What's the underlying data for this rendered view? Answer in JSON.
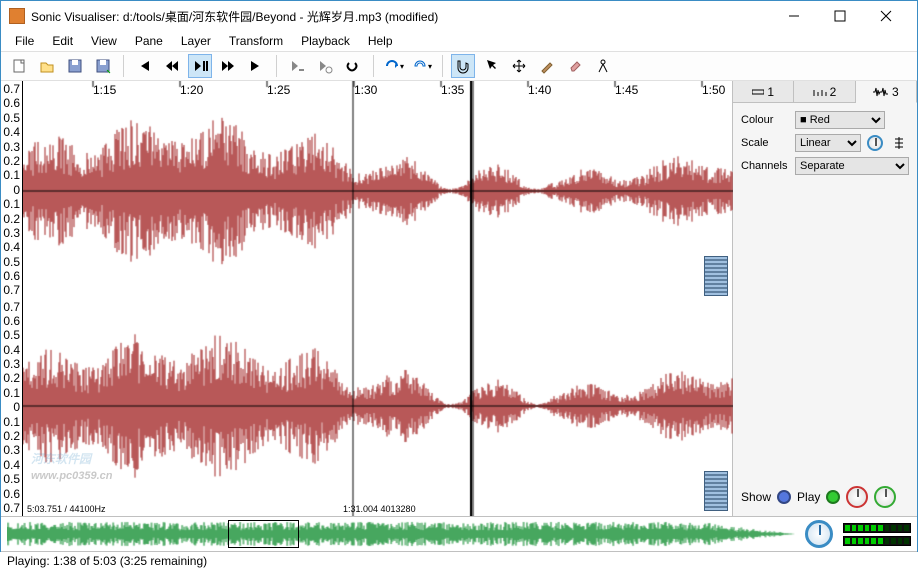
{
  "window": {
    "title": "Sonic Visualiser: d:/tools/桌面/河东软件园/Beyond - 光辉岁月.mp3 (modified)"
  },
  "menu": [
    "File",
    "Edit",
    "View",
    "Pane",
    "Layer",
    "Transform",
    "Playback",
    "Help"
  ],
  "toolbar_groups": {
    "file": [
      "new-file-icon",
      "open-file-icon",
      "save-file-icon",
      "import-audio-icon"
    ],
    "transport": [
      "rewind-start-icon",
      "rewind-icon",
      "play-pause-icon",
      "ffwd-icon",
      "ffwd-end-icon"
    ],
    "record": [
      "record-icon",
      "loop-icon",
      "solo-icon"
    ],
    "segment": [
      "playback-mode-icon",
      "restrict-icon"
    ],
    "tools": [
      "navigate-icon",
      "select-icon",
      "move-icon",
      "draw-icon",
      "erase-icon",
      "measure-icon"
    ]
  },
  "time_labels": [
    "1:15",
    "1:20",
    "1:25",
    "1:30",
    "1:35",
    "1:40",
    "1:45",
    "1:50"
  ],
  "yaxis_labels": [
    "0.7",
    "0.6",
    "0.5",
    "0.4",
    "0.3",
    "0.2",
    "0.1",
    "0",
    "0.1",
    "0.2",
    "0.3",
    "0.4",
    "0.5",
    "0.6",
    "0.7"
  ],
  "info_left": "5:03.751 / 44100Hz",
  "info_cursor": "1:31.004  4013280",
  "panel": {
    "tabs": [
      {
        "icon": "ruler-icon",
        "label": "1"
      },
      {
        "icon": "ruler-icon",
        "label": "2"
      },
      {
        "icon": "waveform-icon",
        "label": "3"
      }
    ],
    "fields": {
      "colour_label": "Colour",
      "colour_value": "Red",
      "scale_label": "Scale",
      "scale_value": "Linear",
      "channels_label": "Channels",
      "channels_value": "Separate"
    },
    "footer": {
      "show_label": "Show",
      "play_label": "Play"
    }
  },
  "status": "Playing: 1:38 of 5:03 (3:25 remaining)",
  "watermark": {
    "name": "河东软件园",
    "url": "www.pc0359.cn"
  }
}
